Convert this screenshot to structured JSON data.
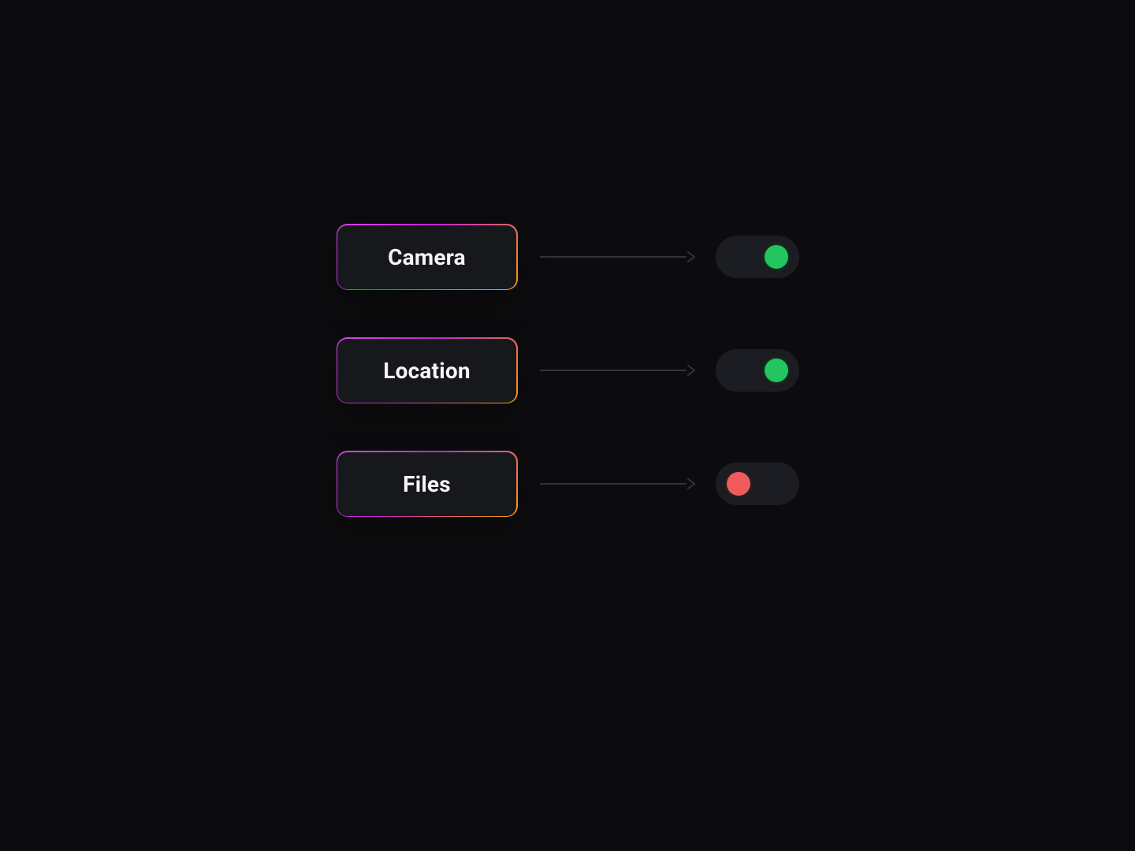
{
  "permissions": [
    {
      "label": "Camera",
      "enabled": true
    },
    {
      "label": "Location",
      "enabled": true
    },
    {
      "label": "Files",
      "enabled": false
    }
  ],
  "colors": {
    "on": "#22c55e",
    "off": "#ef5b5b",
    "card_bg": "#17181c",
    "page_bg": "#0c0c0e"
  }
}
